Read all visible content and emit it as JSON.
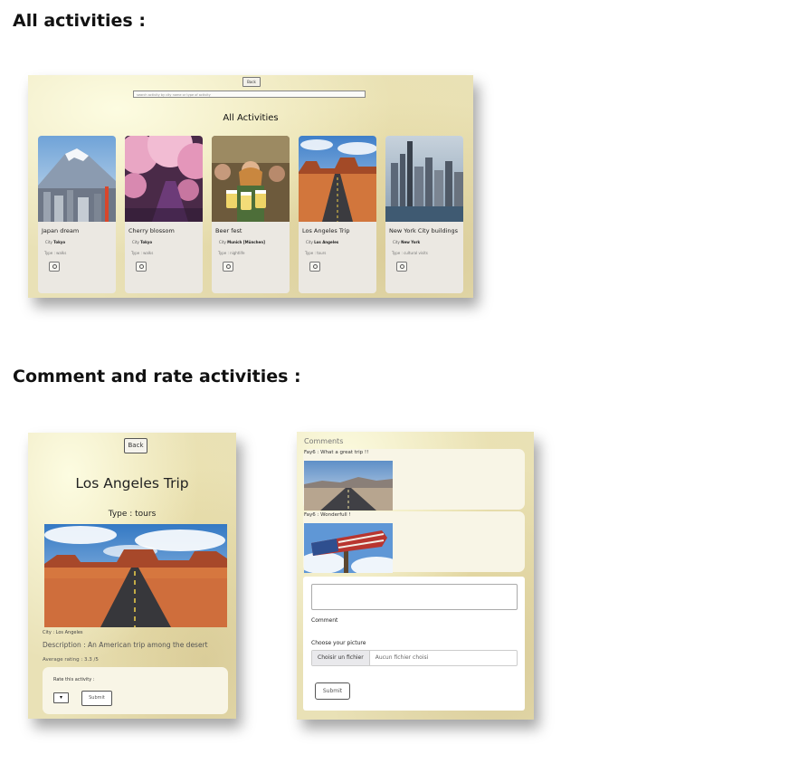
{
  "sections": {
    "all_activities_title": "All activities :",
    "comment_rate_title": "Comment and rate activities :"
  },
  "activities_page": {
    "back_label": "Back",
    "search_placeholder": "search activity by city name or type of activity",
    "heading": "All Activities",
    "cards": [
      {
        "name": "Japan dream",
        "city_label": "City",
        "city": "Tokyo",
        "type": "Type : walks"
      },
      {
        "name": "Cherry blossom",
        "city_label": "City",
        "city": "Tokyo",
        "type": "Type : walks"
      },
      {
        "name": "Beer fest",
        "city_label": "City",
        "city": "Munich [München]",
        "type": "Type : nightlife"
      },
      {
        "name": "Los Angeles Trip",
        "city_label": "City",
        "city": "Los Angeles",
        "type": "Type : tours"
      },
      {
        "name": "New York City buildings",
        "city_label": "City",
        "city": "New York",
        "type": "Type : cultural visits"
      }
    ]
  },
  "detail_page": {
    "back_label": "Back",
    "title": "Los Angeles Trip",
    "type": "Type : tours",
    "city": "City : Los Angeles",
    "description": "Description : An American trip among the desert",
    "average_rating": "Average rating : 3.3 /5",
    "rate_label": "Rate this activity :",
    "rate_value": "",
    "submit_label": "Submit"
  },
  "comments_page": {
    "heading": "Comments",
    "comments": [
      {
        "text": "Fay6 : What a great trip !!"
      },
      {
        "text": "Fay6 : Wonderfull !"
      }
    ],
    "comment_label": "Comment",
    "picture_label": "Choose your picture",
    "file_button": "Choisir un fichier",
    "file_status": "Aucun fichier choisi",
    "submit_label": "Submit"
  }
}
